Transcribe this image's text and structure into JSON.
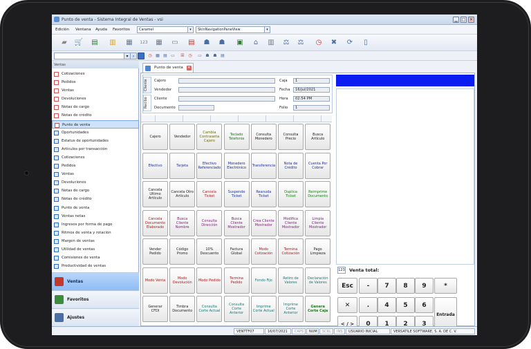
{
  "window": {
    "title": "Punto de venta - Sistema Integral de Ventas - vsi"
  },
  "menu": {
    "items": [
      "Edición",
      "Ventana",
      "Ayuda",
      "Favoritos"
    ],
    "theme_value": "Caramel",
    "view_value": "SkinNavigationPaneView"
  },
  "sidebar": {
    "header": "Ventas",
    "items": [
      {
        "label": "Cotizaciones",
        "type": "doc"
      },
      {
        "label": "Pedidos",
        "type": "doc"
      },
      {
        "label": "Ventas",
        "type": "doc"
      },
      {
        "label": "Devoluciones",
        "type": "doc"
      },
      {
        "label": "Notas de cargo",
        "type": "doc"
      },
      {
        "label": "Notas de crédito",
        "type": "doc"
      },
      {
        "label": "Punto de venta",
        "type": "doc",
        "selected": true
      },
      {
        "label": "Oportunidades",
        "type": "alt"
      },
      {
        "label": "Estatus de oportunidades",
        "type": "alt"
      },
      {
        "label": "Artículos por transacción",
        "type": "alt"
      },
      {
        "label": "Cotizaciones",
        "type": "alt"
      },
      {
        "label": "Pedidos",
        "type": "alt"
      },
      {
        "label": "Ventas",
        "type": "alt"
      },
      {
        "label": "Devoluciones",
        "type": "alt"
      },
      {
        "label": "Notas de cargo",
        "type": "alt"
      },
      {
        "label": "Notas de crédito",
        "type": "alt"
      },
      {
        "label": "Punto de venta",
        "type": "alt"
      },
      {
        "label": "Ventas netas",
        "type": "alt"
      },
      {
        "label": "Ingresos por forma de pago",
        "type": "alt"
      },
      {
        "label": "Ritmos de venta y rotación",
        "type": "alt"
      },
      {
        "label": "Margen de ventas",
        "type": "alt"
      },
      {
        "label": "Utilidad de ventas",
        "type": "alt"
      },
      {
        "label": "Comisiones de venta",
        "type": "alt"
      },
      {
        "label": "Productividad de ventas",
        "type": "alt"
      }
    ],
    "sections": [
      {
        "label": "Ventas",
        "active": true,
        "color": "#c0392b"
      },
      {
        "label": "Favoritos",
        "active": false,
        "color": "#3d8b3d"
      },
      {
        "label": "Ajustes",
        "active": false,
        "color": "#4a6fa5"
      }
    ]
  },
  "tab": {
    "label": "Punto de venta"
  },
  "form": {
    "vtabs": [
      "Cliente",
      "Recibo"
    ],
    "left": [
      {
        "label": "Cajero",
        "value": ""
      },
      {
        "label": "Vendedor",
        "value": ""
      },
      {
        "label": "Cliente",
        "value": ""
      },
      {
        "label": "Documento",
        "value": ""
      }
    ],
    "right": [
      {
        "label": "Caja",
        "value": "1"
      },
      {
        "label": "Fecha",
        "value": "16/jul/2021"
      },
      {
        "label": "Hora",
        "value": "02:54 PM"
      },
      {
        "label": "Folio",
        "value": "1"
      }
    ]
  },
  "buttons": [
    [
      {
        "t": "Cajero",
        "c": "#222"
      },
      {
        "t": "Vendedor",
        "c": "#222"
      },
      {
        "t": "Cambia Contraseña Cajero",
        "c": "#6b6b10"
      },
      {
        "t": "Teclado Telefonía",
        "c": "#1b7a1b"
      },
      {
        "t": "Consulta Monedero",
        "c": "#222"
      },
      {
        "t": "Consulta Precio",
        "c": "#222"
      },
      {
        "t": "Busca Artículo",
        "c": "#222"
      }
    ],
    [
      {
        "t": "Efectivo",
        "c": "#1a2fa8"
      },
      {
        "t": "Tarjeta",
        "c": "#1a2fa8"
      },
      {
        "t": "Efectivo Referenciado",
        "c": "#1a2fa8"
      },
      {
        "t": "Monedero Electrónico",
        "c": "#1a2fa8"
      },
      {
        "t": "Transferencia",
        "c": "#1a2fa8"
      },
      {
        "t": "Nota de Crédito",
        "c": "#1a2fa8"
      },
      {
        "t": "Cuenta Por Cobrar",
        "c": "#1a2fa8"
      }
    ],
    [
      {
        "t": "Cancela Ultimo Artículo",
        "c": "#222"
      },
      {
        "t": "Cancela Otro Artículo",
        "c": "#222"
      },
      {
        "t": "Cancela Ticket",
        "c": "#b01818"
      },
      {
        "t": "Suspende Ticket",
        "c": "#1a2fa8"
      },
      {
        "t": "Reanuda Ticket",
        "c": "#1a2fa8"
      },
      {
        "t": "Duplica Ticket",
        "c": "#1b7a1b"
      },
      {
        "t": "Reimprime Documento",
        "c": "#1b7a1b"
      }
    ],
    [
      {
        "t": "Cancela Documento Elaborado",
        "c": "#b01818"
      },
      {
        "t": "Busca Cliente Nombre",
        "c": "#7a1a7a"
      },
      {
        "t": "Consulta Dirección",
        "c": "#7a1a7a"
      },
      {
        "t": "Busca Cliente Mostrador",
        "c": "#7a1a7a"
      },
      {
        "t": "Crea Cliente Mostrador",
        "c": "#7a1a7a"
      },
      {
        "t": "Modifica Cliente Mostrador",
        "c": "#7a1a7a"
      },
      {
        "t": "Limpia Cliente Mostrador",
        "c": "#7a1a7a"
      }
    ],
    [
      {
        "t": "Vender Pedido",
        "c": "#222"
      },
      {
        "t": "Código Promo",
        "c": "#222"
      },
      {
        "t": "10% Descuento",
        "c": "#222"
      },
      {
        "t": "Factura Global",
        "c": "#222"
      },
      {
        "t": "Modo Cotización",
        "c": "#b01818"
      },
      {
        "t": "Termina Cotización",
        "c": "#b01818"
      },
      {
        "t": "Pago Limpieza",
        "c": "#222"
      }
    ],
    [
      {
        "t": "Modo Venta",
        "c": "#b01818"
      },
      {
        "t": "Modo Devolución",
        "c": "#b01818"
      },
      {
        "t": "Modo Pedido",
        "c": "#b01818"
      },
      {
        "t": "Termina Pedido",
        "c": "#b01818"
      },
      {
        "t": "Fondo Fijo",
        "c": "#137a7a"
      },
      {
        "t": "Retiro de Valores",
        "c": "#137a7a"
      },
      {
        "t": "Declaración de Valores",
        "c": "#137a7a"
      }
    ],
    [
      {
        "t": "Generar CFDI",
        "c": "#222"
      },
      {
        "t": "Timbra Documento",
        "c": "#222"
      },
      {
        "t": "Consulta Corte Actual",
        "c": "#137a7a"
      },
      {
        "t": "Consulta Corte Anterior",
        "c": "#137a7a"
      },
      {
        "t": "Imprime Corte Actual",
        "c": "#137a7a"
      },
      {
        "t": "Imprime Corte Anterior",
        "c": "#137a7a"
      },
      {
        "t": "Genera Corte Caja",
        "c": "#1b7a1b",
        "bold": true
      }
    ]
  ],
  "total": {
    "icon": "123",
    "label": "Venta total:"
  },
  "keypad": [
    [
      "Esc",
      "-",
      "7",
      "8",
      "9",
      "*"
    ],
    [
      "✕",
      ".",
      "4",
      "5",
      "6",
      "Entrada"
    ],
    [
      "< / >",
      "0",
      "1",
      "2",
      "3"
    ]
  ],
  "status": {
    "cells": [
      {
        "t": "VENTTF07",
        "dim": false
      },
      {
        "t": "16/07/2021",
        "dim": false
      },
      {
        "t": "CAPS",
        "dim": true
      },
      {
        "t": "NUM",
        "dim": false
      },
      {
        "t": "SCRL",
        "dim": true
      },
      {
        "t": "INS",
        "dim": true
      },
      {
        "t": "USUARIO INICIAL",
        "dim": false
      },
      {
        "t": "VERSATILE SOFTWARE, S. A. DE C. V.",
        "dim": false
      }
    ]
  }
}
